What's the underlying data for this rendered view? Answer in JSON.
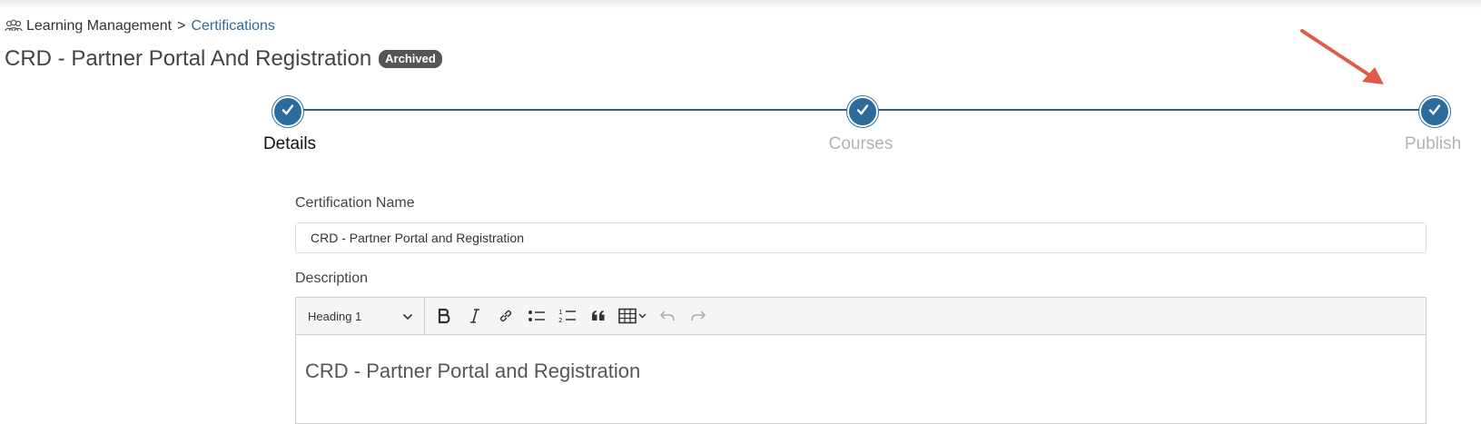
{
  "breadcrumb": {
    "icon": "users-group-icon",
    "root": "Learning Management",
    "separator": ">",
    "current": "Certifications"
  },
  "page": {
    "title": "CRD - Partner Portal And Registration",
    "status_badge": "Archived"
  },
  "stepper": {
    "steps": [
      {
        "label": "Details",
        "state": "active"
      },
      {
        "label": "Courses",
        "state": "completed"
      },
      {
        "label": "Publish",
        "state": "completed"
      }
    ]
  },
  "form": {
    "name_label": "Certification Name",
    "name_value": "CRD - Partner Portal and Registration",
    "description_label": "Description",
    "editor": {
      "heading_select": "Heading 1",
      "tools": [
        "bold-icon",
        "italic-icon",
        "link-icon",
        "bullet-list-icon",
        "numbered-list-icon",
        "quote-icon",
        "table-icon",
        "undo-icon",
        "redo-icon"
      ],
      "content": "CRD - Partner Portal and Registration"
    }
  },
  "colors": {
    "accent": "#2c6b9c",
    "link": "#2a6d9e",
    "annotation_arrow": "#e05a45"
  }
}
